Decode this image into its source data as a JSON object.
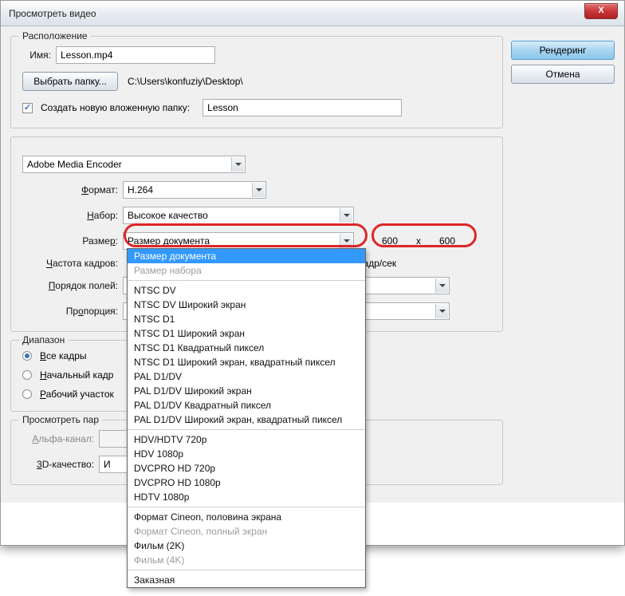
{
  "title": "Просмотреть видео",
  "buttons": {
    "render": "Рендеринг",
    "cancel": "Отмена",
    "browse": "Выбрать папку...",
    "close": "X"
  },
  "location": {
    "legend": "Расположение",
    "name_label": "Имя:",
    "name_value": "Lesson.mp4",
    "path": "C:\\Users\\konfuziy\\Desktop\\",
    "subfolder_label": "Создать новую вложенную папку:",
    "subfolder_value": "Lesson"
  },
  "encoder": {
    "title": "Adobe Media Encoder",
    "format_label": "Формат:",
    "format_value": "H.264",
    "preset_label": "Набор:",
    "preset_value": "Высокое качество",
    "size_label": "Размер:",
    "size_value": "Размер документа",
    "width": "600",
    "x": "x",
    "height": "600",
    "fps_label": "Частота кадров:",
    "fps_unit": "кадр/сек",
    "field_label": "Порядок полей:",
    "aspect_label": "Пропорция:"
  },
  "range": {
    "legend": "Диапазон",
    "all": "Все кадры",
    "start": "Начальный кадр",
    "work": "Рабочий участок"
  },
  "render_opts": {
    "legend": "Просмотреть пар",
    "alpha_label": "Альфа-канал:",
    "quality_label": "3D-качество:",
    "quality_value": "И"
  },
  "dropdown": [
    {
      "t": "Размер документа",
      "sel": true
    },
    {
      "t": "Размер набора",
      "dis": true
    },
    {
      "sep": true
    },
    {
      "t": "NTSC DV"
    },
    {
      "t": "NTSC DV Широкий экран"
    },
    {
      "t": "NTSC D1"
    },
    {
      "t": "NTSC D1 Широкий экран"
    },
    {
      "t": "NTSC D1 Квадратный пиксел"
    },
    {
      "t": "NTSC D1 Широкий экран, квадратный пиксел"
    },
    {
      "t": "PAL D1/DV"
    },
    {
      "t": "PAL D1/DV Широкий экран"
    },
    {
      "t": "PAL D1/DV Квадратный пиксел"
    },
    {
      "t": "PAL D1/DV Широкий экран, квадратный пиксел"
    },
    {
      "sep": true
    },
    {
      "t": "HDV/HDTV 720p"
    },
    {
      "t": "HDV 1080p"
    },
    {
      "t": "DVCPRO HD 720p"
    },
    {
      "t": "DVCPRO HD 1080p"
    },
    {
      "t": "HDTV 1080p"
    },
    {
      "sep": true
    },
    {
      "t": "Формат Cineon, половина экрана"
    },
    {
      "t": "Формат Cineon, полный экран",
      "dis": true
    },
    {
      "t": "Фильм (2K)"
    },
    {
      "t": "Фильм (4K)",
      "dis": true
    },
    {
      "sep": true
    },
    {
      "t": "Заказная"
    }
  ]
}
